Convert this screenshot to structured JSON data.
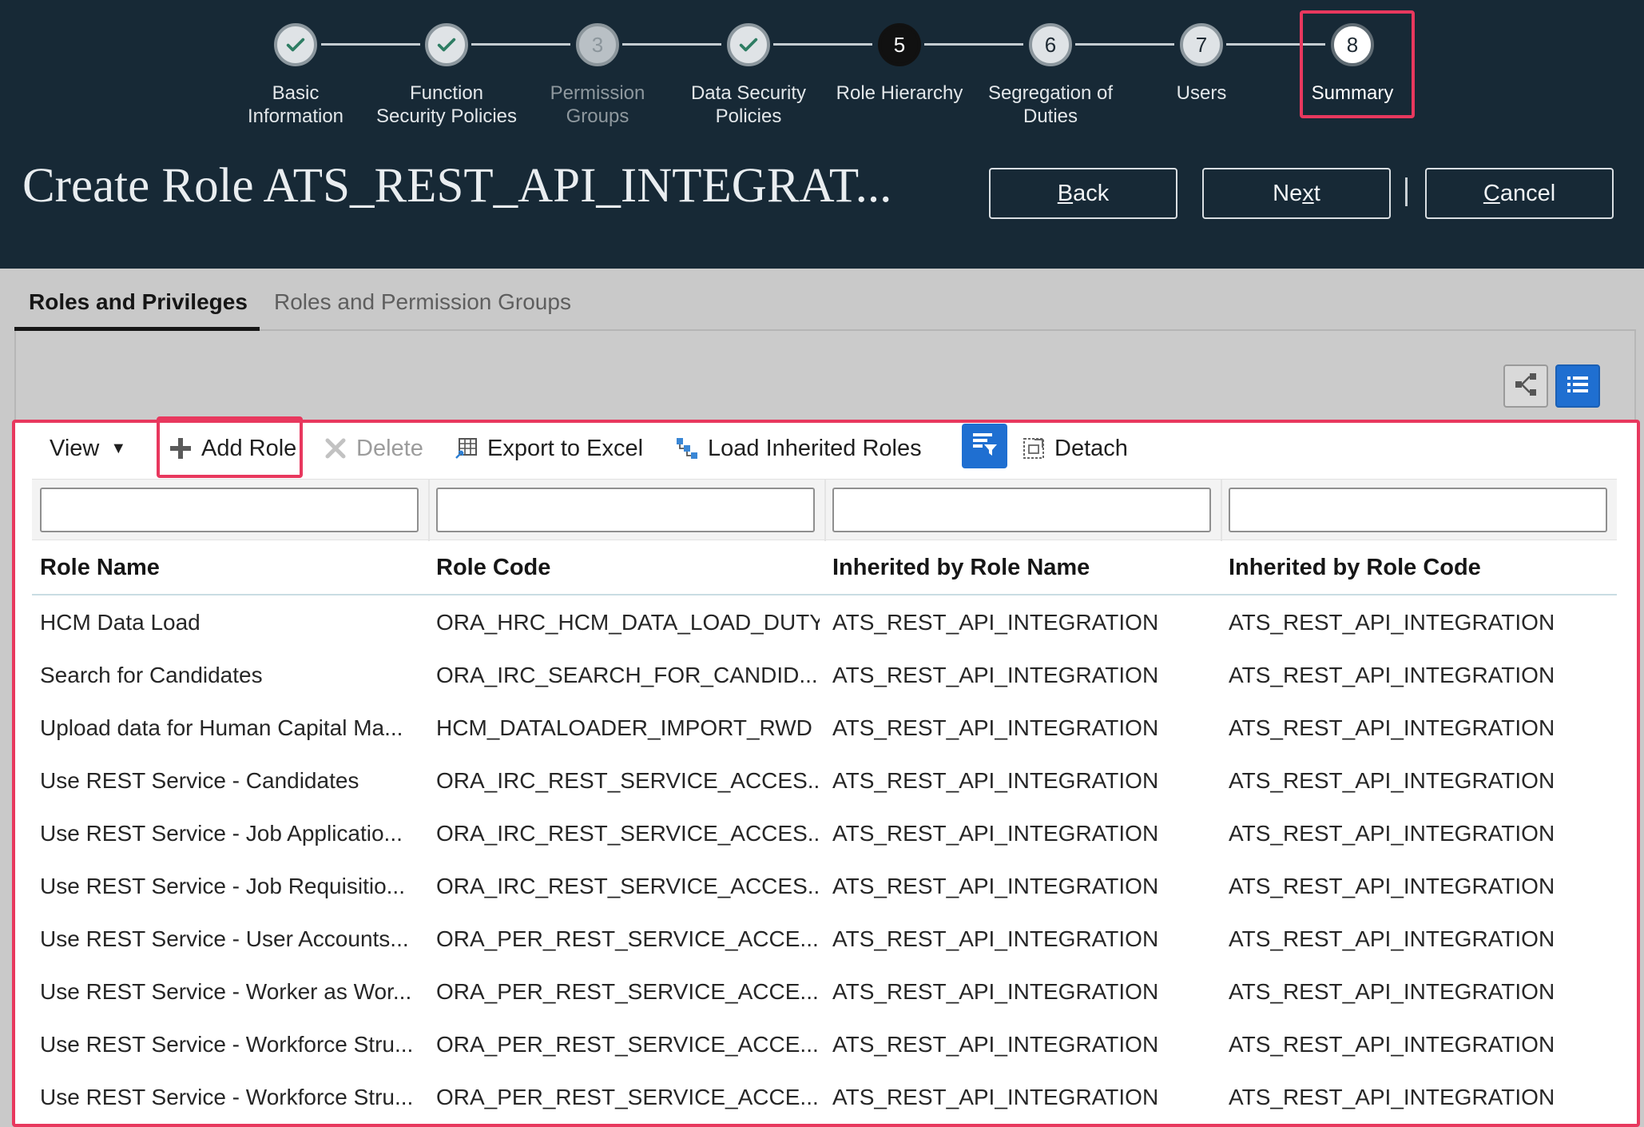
{
  "train": {
    "steps": [
      {
        "number": "",
        "label_line1": "Basic",
        "label_line2": "Information",
        "state": "done"
      },
      {
        "number": "",
        "label_line1": "Function",
        "label_line2": "Security Policies",
        "state": "done"
      },
      {
        "number": "3",
        "label_line1": "Permission",
        "label_line2": "Groups",
        "state": "disabled"
      },
      {
        "number": "",
        "label_line1": "Data Security",
        "label_line2": "Policies",
        "state": "done"
      },
      {
        "number": "5",
        "label_line1": "Role Hierarchy",
        "label_line2": "",
        "state": "current"
      },
      {
        "number": "6",
        "label_line1": "Segregation of",
        "label_line2": "Duties",
        "state": "visited"
      },
      {
        "number": "7",
        "label_line1": "Users",
        "label_line2": "",
        "state": "visited"
      },
      {
        "number": "8",
        "label_line1": "Summary",
        "label_line2": "",
        "state": "selected"
      }
    ]
  },
  "header": {
    "title": "Create Role ATS_REST_API_INTEGRAT...",
    "back_prefix": "B",
    "back_rest": "ack",
    "next_prefix": "Ne",
    "next_underline": "x",
    "next_rest": "t",
    "cancel_prefix": "C",
    "cancel_rest": "ancel"
  },
  "tabs": {
    "active": "Roles and Privileges",
    "inactive": "Roles and Permission Groups"
  },
  "toolbar": {
    "view": "View",
    "add_role": "Add Role",
    "delete": "Delete",
    "export": "Export to Excel",
    "load_inherited": "Load Inherited Roles",
    "detach": "Detach"
  },
  "table": {
    "columns": [
      "Role Name",
      "Role Code",
      "Inherited by Role Name",
      "Inherited by Role Code"
    ],
    "rows": [
      [
        "HCM Data Load",
        "ORA_HRC_HCM_DATA_LOAD_DUTY",
        "ATS_REST_API_INTEGRATION",
        "ATS_REST_API_INTEGRATION"
      ],
      [
        "Search for Candidates",
        "ORA_IRC_SEARCH_FOR_CANDID...",
        "ATS_REST_API_INTEGRATION",
        "ATS_REST_API_INTEGRATION"
      ],
      [
        "Upload data for Human Capital Ma...",
        "HCM_DATALOADER_IMPORT_RWD",
        "ATS_REST_API_INTEGRATION",
        "ATS_REST_API_INTEGRATION"
      ],
      [
        "Use REST Service - Candidates",
        "ORA_IRC_REST_SERVICE_ACCES...",
        "ATS_REST_API_INTEGRATION",
        "ATS_REST_API_INTEGRATION"
      ],
      [
        "Use REST Service - Job Applicatio...",
        "ORA_IRC_REST_SERVICE_ACCES...",
        "ATS_REST_API_INTEGRATION",
        "ATS_REST_API_INTEGRATION"
      ],
      [
        "Use REST Service - Job Requisitio...",
        "ORA_IRC_REST_SERVICE_ACCES...",
        "ATS_REST_API_INTEGRATION",
        "ATS_REST_API_INTEGRATION"
      ],
      [
        "Use REST Service - User Accounts...",
        "ORA_PER_REST_SERVICE_ACCE...",
        "ATS_REST_API_INTEGRATION",
        "ATS_REST_API_INTEGRATION"
      ],
      [
        "Use REST Service - Worker as Wor...",
        "ORA_PER_REST_SERVICE_ACCE...",
        "ATS_REST_API_INTEGRATION",
        "ATS_REST_API_INTEGRATION"
      ],
      [
        "Use REST Service - Workforce Stru...",
        "ORA_PER_REST_SERVICE_ACCE...",
        "ATS_REST_API_INTEGRATION",
        "ATS_REST_API_INTEGRATION"
      ],
      [
        "Use REST Service - Workforce Stru...",
        "ORA_PER_REST_SERVICE_ACCE...",
        "ATS_REST_API_INTEGRATION",
        "ATS_REST_API_INTEGRATION"
      ]
    ]
  },
  "colors": {
    "header_bg": "#172936",
    "highlight": "#e8385e",
    "accent_blue": "#1f6fd1"
  }
}
